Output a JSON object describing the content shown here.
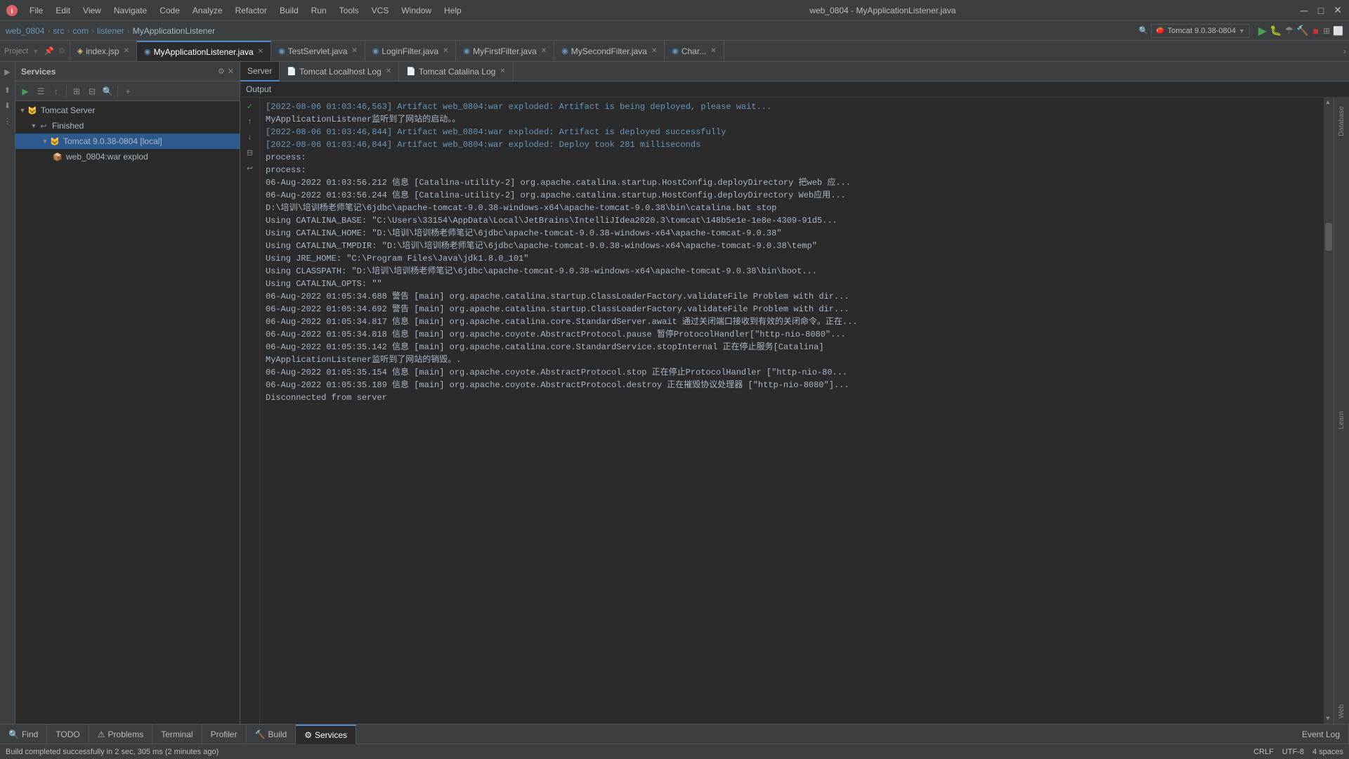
{
  "titleBar": {
    "title": "web_0804 - MyApplicationListener.java",
    "menus": [
      "File",
      "Edit",
      "View",
      "Navigate",
      "Code",
      "Analyze",
      "Refactor",
      "Build",
      "Run",
      "Tools",
      "VCS",
      "Window",
      "Help"
    ]
  },
  "breadcrumb": {
    "items": [
      "web_0804",
      "src",
      "com",
      "listener",
      "MyApplicationListener"
    ]
  },
  "tabs": [
    {
      "label": "index.jsp",
      "type": "jsp",
      "active": false
    },
    {
      "label": "MyApplicationListener.java",
      "type": "java",
      "active": true
    },
    {
      "label": "TestServlet.java",
      "type": "java",
      "active": false
    },
    {
      "label": "LoginFilter.java",
      "type": "java",
      "active": false
    },
    {
      "label": "MyFirstFilter.java",
      "type": "java",
      "active": false
    },
    {
      "label": "MySecondFilter.java",
      "type": "java",
      "active": false
    },
    {
      "label": "Char...",
      "type": "java",
      "active": false
    }
  ],
  "runConfig": {
    "label": "Tomcat 9.0.38-0804"
  },
  "servicesPanel": {
    "title": "Services",
    "tree": [
      {
        "id": "tomcat-server",
        "label": "Tomcat Server",
        "indent": 0,
        "type": "server"
      },
      {
        "id": "finished",
        "label": "Finished",
        "indent": 1,
        "type": "status"
      },
      {
        "id": "tomcat-instance",
        "label": "Tomcat 9.0.38-0804 [local]",
        "indent": 2,
        "type": "running",
        "selected": true
      },
      {
        "id": "artifact",
        "label": "web_0804:war explod",
        "indent": 3,
        "type": "artifact"
      }
    ]
  },
  "serverTabs": [
    {
      "label": "Server",
      "active": true
    },
    {
      "label": "Tomcat Localhost Log",
      "active": false
    },
    {
      "label": "Tomcat Catalina Log",
      "active": false
    }
  ],
  "output": {
    "header": "Output",
    "lines": [
      {
        "text": "[2022-08-06 01:03:46,563] Artifact web_0804:war exploded: Artifact is being deployed, please wait...",
        "color": "blue"
      },
      {
        "text": "MyApplicationListener监听到了网站的启动。。",
        "color": "white"
      },
      {
        "text": "[2022-08-06 01:03:46,844] Artifact web_0804:war exploded: Artifact is deployed successfully",
        "color": "blue"
      },
      {
        "text": "[2022-08-06 01:03:46,844] Artifact web_0804:war exploded: Deploy took 281 milliseconds",
        "color": "blue"
      },
      {
        "text": "process:",
        "color": "white"
      },
      {
        "text": "process:",
        "color": "white"
      },
      {
        "text": "06-Aug-2022 01:03:56.212 信息 [Catalina-utility-2] org.apache.catalina.startup.HostConfig.deployDirectory 把web 应...",
        "color": "white"
      },
      {
        "text": "06-Aug-2022 01:03:56.244 信息 [Catalina-utility-2] org.apache.catalina.startup.HostConfig.deployDirectory Web应用...",
        "color": "white"
      },
      {
        "text": "D:\\培训\\培训杨老师笔记\\6jdbc\\apache-tomcat-9.0.38-windows-x64\\apache-tomcat-9.0.38\\bin\\catalina.bat stop",
        "color": "white"
      },
      {
        "text": "Using CATALINA_BASE:   \"C:\\Users\\33154\\AppData\\Local\\JetBrains\\IntelliJIdea2020.3\\tomcat\\148b5e1e-1e8e-4309-91d5...",
        "color": "white"
      },
      {
        "text": "Using CATALINA_HOME:   \"D:\\培训\\培训杨老师笔记\\6jdbc\\apache-tomcat-9.0.38-windows-x64\\apache-tomcat-9.0.38\"",
        "color": "white"
      },
      {
        "text": "Using CATALINA_TMPDIR: \"D:\\培训\\培训杨老师笔记\\6jdbc\\apache-tomcat-9.0.38-windows-x64\\apache-tomcat-9.0.38\\temp\"",
        "color": "white"
      },
      {
        "text": "Using JRE_HOME:        \"C:\\Program Files\\Java\\jdk1.8.0_101\"",
        "color": "white"
      },
      {
        "text": "Using CLASSPATH:       \"D:\\培训\\培训杨老师笔记\\6jdbc\\apache-tomcat-9.0.38-windows-x64\\apache-tomcat-9.0.38\\bin\\boot...",
        "color": "white"
      },
      {
        "text": "Using CATALINA_OPTS:   \"\"",
        "color": "white"
      },
      {
        "text": "06-Aug-2022 01:05:34.688 警告 [main] org.apache.catalina.startup.ClassLoaderFactory.validateFile Problem with dir...",
        "color": "white"
      },
      {
        "text": "06-Aug-2022 01:05:34.692 警告 [main] org.apache.catalina.startup.ClassLoaderFactory.validateFile Problem with dir...",
        "color": "white"
      },
      {
        "text": "06-Aug-2022 01:05:34.817 信息 [main] org.apache.catalina.core.StandardServer.await 通过关闭端口接收到有效的关闭命令。正在...",
        "color": "white"
      },
      {
        "text": "06-Aug-2022 01:05:34.818 信息 [main] org.apache.coyote.AbstractProtocol.pause 暂停ProtocolHandler[\"http-nio-8080\"...",
        "color": "white"
      },
      {
        "text": "06-Aug-2022 01:05:35.142 信息 [main] org.apache.catalina.core.StandardService.stopInternal 正在停止服务[Catalina]",
        "color": "white"
      },
      {
        "text": "MyApplicationListener监听到了网站的销毁。.",
        "color": "white"
      },
      {
        "text": "06-Aug-2022 01:05:35.154 信息 [main] org.apache.coyote.AbstractProtocol.stop 正在停止ProtocolHandler [\"http-nio-80...",
        "color": "white"
      },
      {
        "text": "06-Aug-2022 01:05:35.189 信息 [main] org.apache.coyote.AbstractProtocol.destroy 正在摧毁协议处理器 [\"http-nio-8080\"]...",
        "color": "white"
      },
      {
        "text": "Disconnected from server",
        "color": "white"
      }
    ]
  },
  "bottomTabs": [
    {
      "label": "Find",
      "icon": "🔍"
    },
    {
      "label": "TODO",
      "icon": ""
    },
    {
      "label": "Problems",
      "icon": "⚠"
    },
    {
      "label": "Terminal",
      "icon": ""
    },
    {
      "label": "Profiler",
      "icon": ""
    },
    {
      "label": "Build",
      "icon": "🔨"
    },
    {
      "label": "Services",
      "icon": "⚙",
      "active": true
    },
    {
      "label": "Event Log",
      "icon": ""
    }
  ],
  "statusBar": {
    "left": "Build completed successfully in 2 sec, 305 ms (2 minutes ago)",
    "right": [
      "CRLF",
      "UTF-8",
      "4 spaces"
    ]
  },
  "rightSidebar": {
    "items": [
      "Database",
      "Learn",
      "Web"
    ]
  }
}
